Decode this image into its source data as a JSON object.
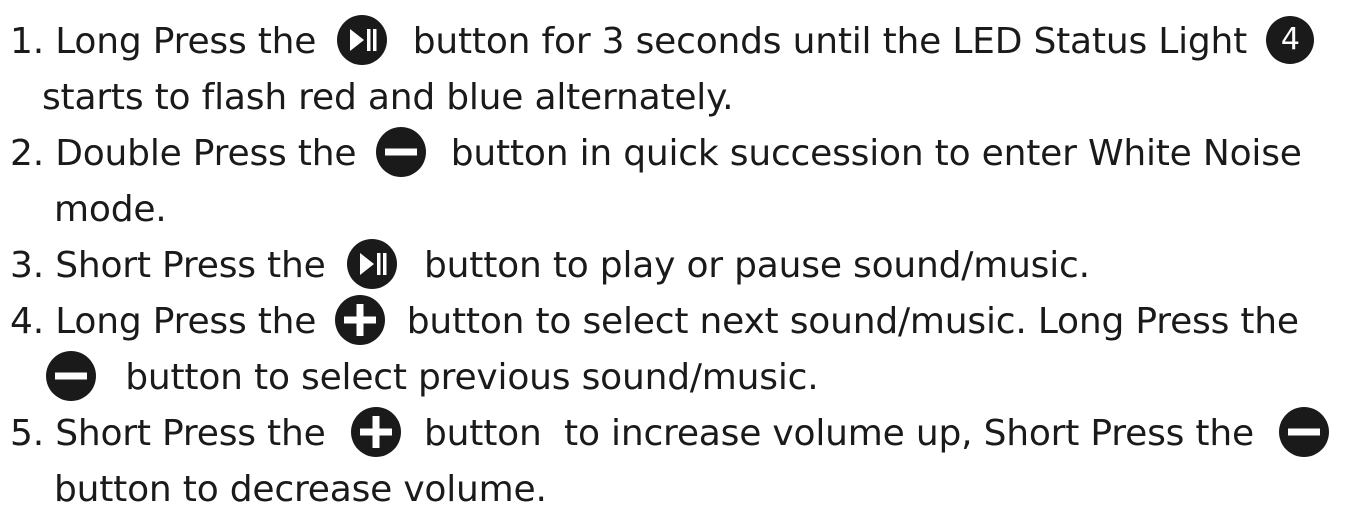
{
  "instructions": [
    {
      "number": "1.",
      "line1_a": "Long Press the",
      "line1_b": "button for 3 seconds until the LED Status Light",
      "badge": "4",
      "line2": "starts to flash red and blue alternately."
    },
    {
      "number": "2.",
      "line1_a": "Double Press the",
      "line1_b": "button in quick succession to enter White Noise",
      "line2": "mode."
    },
    {
      "number": "3.",
      "line1_a": "Short Press the",
      "line1_b": "button to play or pause sound/music."
    },
    {
      "number": "4.",
      "line1_a": "Long Press the",
      "line1_b": "button to select next sound/music. Long Press the",
      "line2": "button to select previous sound/music."
    },
    {
      "number": "5.",
      "line1_a": "Short Press the",
      "line1_b": "button  to increase volume up, Short Press the",
      "line2": "button to decrease volume."
    }
  ],
  "icons": {
    "play_pause": "play-pause-icon",
    "minus": "minus-icon",
    "plus": "plus-icon"
  },
  "colors": {
    "text": "#1a1a1a",
    "icon_fill": "#1a1a1a",
    "background": "#ffffff"
  }
}
